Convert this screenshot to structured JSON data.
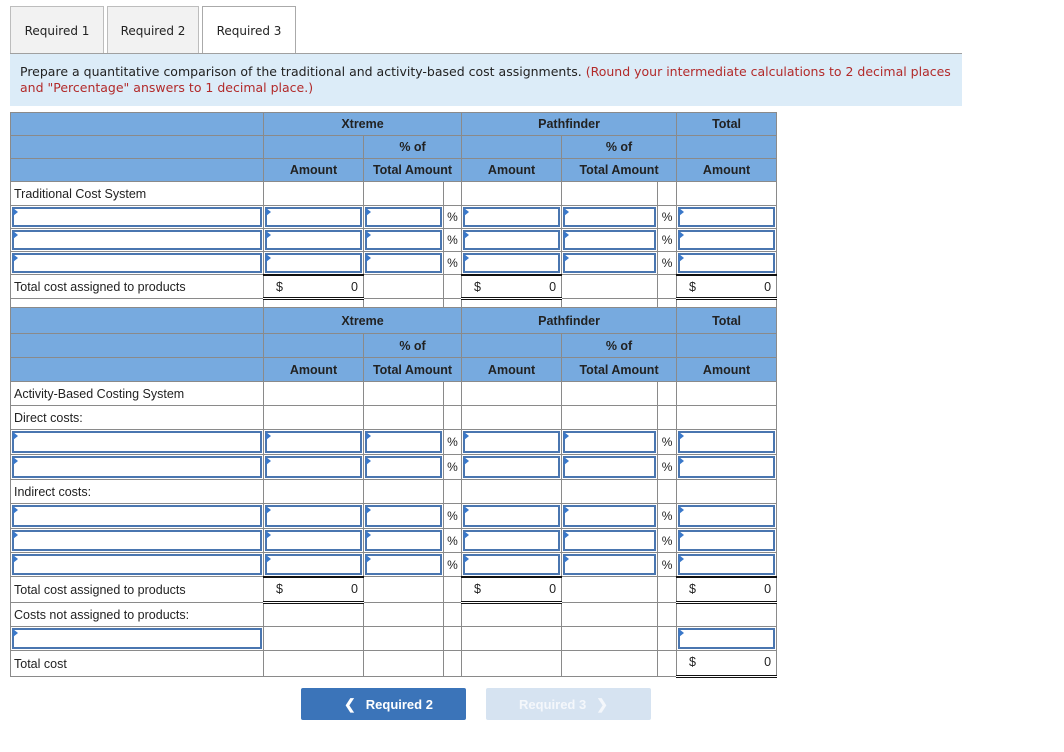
{
  "tabs": [
    {
      "label": "Required 1",
      "active": false
    },
    {
      "label": "Required 2",
      "active": false
    },
    {
      "label": "Required 3",
      "active": true
    }
  ],
  "instructions": {
    "text": "Prepare a quantitative comparison of the traditional and activity-based cost assignments.",
    "note": "(Round your intermediate calculations to 2 decimal places and \"Percentage\" answers to 1 decimal place.)"
  },
  "headers": {
    "xtreme": "Xtreme",
    "pathfinder": "Pathfinder",
    "total": "Total",
    "pct_of": "% of",
    "amount": "Amount",
    "total_amount": "Total Amount"
  },
  "traditional": {
    "section_label": "Traditional Cost System",
    "total_label": "Total cost assigned to products",
    "currency": "$",
    "totals": {
      "xtreme": "0",
      "pathfinder": "0",
      "total": "0"
    },
    "pct_sign": "%"
  },
  "abc": {
    "section_label": "Activity-Based Costing System",
    "direct_label": "Direct costs:",
    "indirect_label": "Indirect costs:",
    "total_label": "Total cost assigned to products",
    "not_assigned_label": "Costs not assigned to products:",
    "total_cost_label": "Total cost",
    "currency": "$",
    "totals": {
      "xtreme": "0",
      "pathfinder": "0",
      "total": "0"
    },
    "grand_total": "0",
    "pct_sign": "%"
  },
  "nav": {
    "prev_label": "Required 2",
    "next_label": "Required 3",
    "prev_icon": "chevron-left-icon",
    "next_icon": "chevron-right-icon"
  }
}
